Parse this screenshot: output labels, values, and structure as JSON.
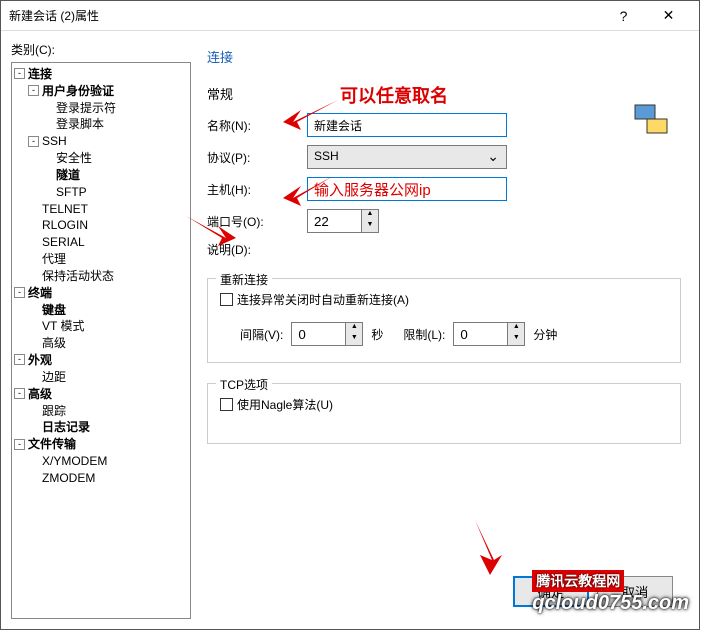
{
  "titlebar": {
    "title": "新建会话 (2)属性",
    "help": "?",
    "close": "✕"
  },
  "category_label": "类别(C):",
  "tree": {
    "items": [
      {
        "label": "连接",
        "bold": true,
        "exp": "-",
        "ind": 0
      },
      {
        "label": "用户身份验证",
        "bold": true,
        "exp": "-",
        "ind": 1
      },
      {
        "label": "登录提示符",
        "bold": false,
        "ind": 2
      },
      {
        "label": "登录脚本",
        "bold": false,
        "ind": 2
      },
      {
        "label": "SSH",
        "bold": false,
        "exp": "-",
        "ind": 1
      },
      {
        "label": "安全性",
        "bold": false,
        "ind": 2
      },
      {
        "label": "隧道",
        "bold": true,
        "ind": 2
      },
      {
        "label": "SFTP",
        "bold": false,
        "ind": 2
      },
      {
        "label": "TELNET",
        "bold": false,
        "ind": 1
      },
      {
        "label": "RLOGIN",
        "bold": false,
        "ind": 1
      },
      {
        "label": "SERIAL",
        "bold": false,
        "ind": 1
      },
      {
        "label": "代理",
        "bold": false,
        "ind": 1
      },
      {
        "label": "保持活动状态",
        "bold": false,
        "ind": 1
      },
      {
        "label": "终端",
        "bold": true,
        "exp": "-",
        "ind": 0
      },
      {
        "label": "键盘",
        "bold": true,
        "ind": 1
      },
      {
        "label": "VT 模式",
        "bold": false,
        "ind": 1
      },
      {
        "label": "高级",
        "bold": false,
        "ind": 1
      },
      {
        "label": "外观",
        "bold": true,
        "exp": "-",
        "ind": 0
      },
      {
        "label": "边距",
        "bold": false,
        "ind": 1
      },
      {
        "label": "高级",
        "bold": true,
        "exp": "-",
        "ind": 0
      },
      {
        "label": "跟踪",
        "bold": false,
        "ind": 1
      },
      {
        "label": "日志记录",
        "bold": true,
        "ind": 1
      },
      {
        "label": "文件传输",
        "bold": true,
        "exp": "-",
        "ind": 0
      },
      {
        "label": "X/YMODEM",
        "bold": false,
        "ind": 1
      },
      {
        "label": "ZMODEM",
        "bold": false,
        "ind": 1
      }
    ]
  },
  "right": {
    "section_connect": "连接",
    "section_general": "常规",
    "name_label": "名称(N):",
    "name_value": "新建会话",
    "protocol_label": "协议(P):",
    "protocol_value": "SSH",
    "host_label": "主机(H):",
    "host_value": "输入服务器公网ip",
    "port_label": "端口号(O):",
    "port_value": "22",
    "desc_label": "说明(D):",
    "reconnect_legend": "重新连接",
    "reconnect_checkbox": "连接异常关闭时自动重新连接(A)",
    "interval_label": "间隔(V):",
    "interval_value": "0",
    "interval_unit": "秒",
    "limit_label": "限制(L):",
    "limit_value": "0",
    "limit_unit": "分钟",
    "tcp_legend": "TCP选项",
    "nagle_checkbox": "使用Nagle算法(U)",
    "ok_button": "确定",
    "cancel_button": "取消"
  },
  "annotations": {
    "rename": "可以任意取名"
  },
  "watermark": {
    "line1": "腾讯云教程网",
    "line2": "qcloud0755.com"
  }
}
